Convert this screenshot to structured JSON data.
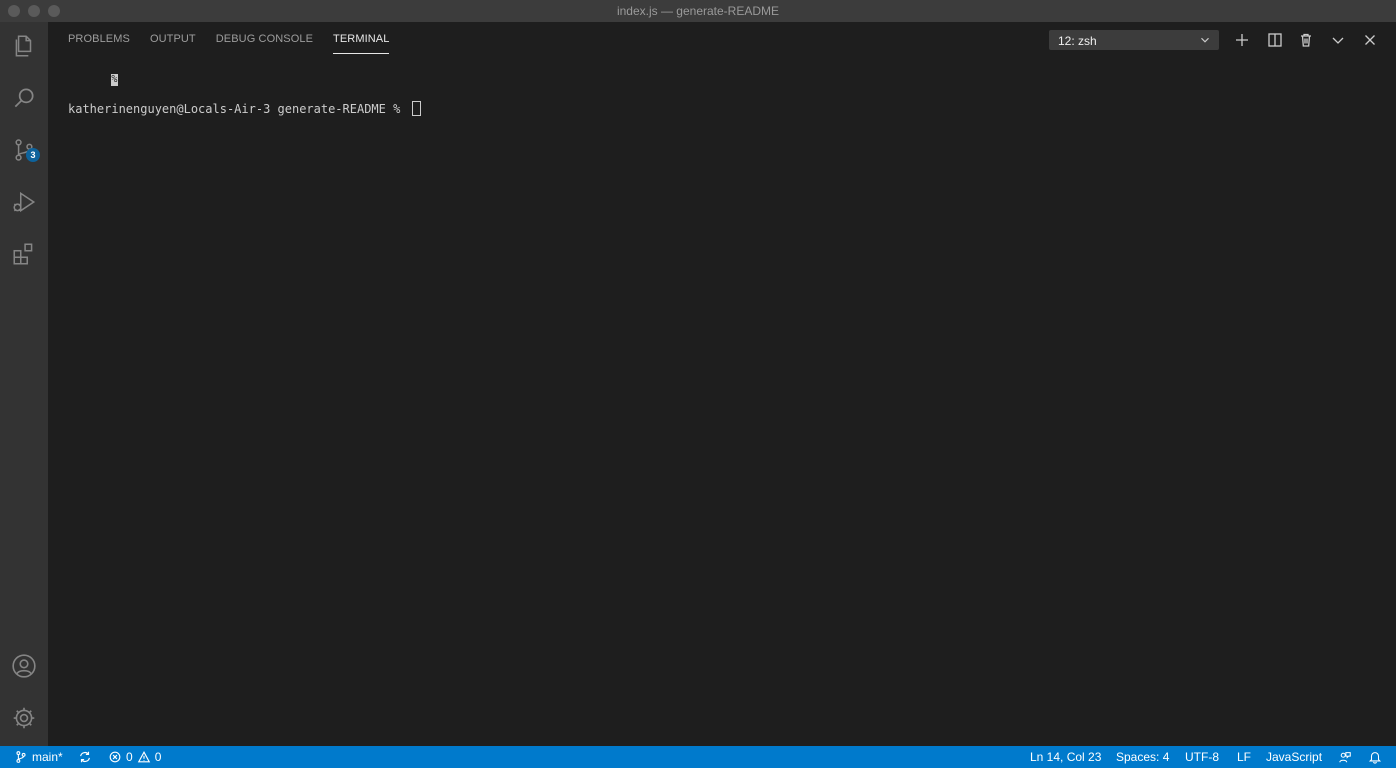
{
  "window": {
    "title": "index.js — generate-README"
  },
  "activity_bar": {
    "items": [
      "explorer-icon",
      "search-icon",
      "source-control-icon",
      "run-debug-icon",
      "extensions-icon"
    ],
    "source_control_badge": "3",
    "bottom": [
      "account-icon",
      "settings-gear-icon"
    ]
  },
  "panel": {
    "tabs": [
      {
        "label": "PROBLEMS"
      },
      {
        "label": "OUTPUT"
      },
      {
        "label": "DEBUG CONSOLE"
      },
      {
        "label": "TERMINAL",
        "active": true
      }
    ],
    "terminal_select": "12: zsh",
    "actions": [
      "add-icon",
      "split-icon",
      "trash-icon",
      "chevron-down-icon",
      "close-icon"
    ]
  },
  "terminal": {
    "line1": "%",
    "line2": "katherinenguyen@Locals-Air-3 generate-README % "
  },
  "status_bar": {
    "branch": "main*",
    "errors": "0",
    "warnings": "0",
    "position": "Ln 14, Col 23",
    "spaces": "Spaces: 4",
    "encoding": "UTF-8",
    "eol": "LF",
    "language": "JavaScript",
    "color": "#007acc"
  }
}
